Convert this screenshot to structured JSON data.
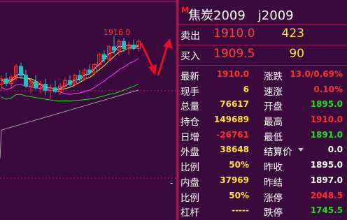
{
  "chart": {
    "high_label": "1916.0",
    "colors": {
      "bg": "#3a0a3d",
      "up": "#ff3030",
      "down": "#20c0c0",
      "ma1": "#ffffff",
      "ma2": "#ffe040",
      "ma3": "#ff40ff",
      "ma4": "#20e020",
      "ma5": "#a0a0a0",
      "arrow": "#e0102a"
    },
    "candles": [
      {
        "o": 1862,
        "h": 1872,
        "l": 1855,
        "c": 1868
      },
      {
        "o": 1868,
        "h": 1875,
        "l": 1860,
        "c": 1863
      },
      {
        "o": 1863,
        "h": 1873,
        "l": 1858,
        "c": 1870
      },
      {
        "o": 1870,
        "h": 1885,
        "l": 1866,
        "c": 1882
      },
      {
        "o": 1882,
        "h": 1886,
        "l": 1868,
        "c": 1872
      },
      {
        "o": 1872,
        "h": 1878,
        "l": 1858,
        "c": 1860
      },
      {
        "o": 1860,
        "h": 1868,
        "l": 1852,
        "c": 1865
      },
      {
        "o": 1865,
        "h": 1872,
        "l": 1856,
        "c": 1858
      },
      {
        "o": 1858,
        "h": 1866,
        "l": 1852,
        "c": 1862
      },
      {
        "o": 1862,
        "h": 1868,
        "l": 1850,
        "c": 1855
      },
      {
        "o": 1855,
        "h": 1862,
        "l": 1846,
        "c": 1858
      },
      {
        "o": 1858,
        "h": 1866,
        "l": 1852,
        "c": 1854
      },
      {
        "o": 1854,
        "h": 1864,
        "l": 1850,
        "c": 1860
      },
      {
        "o": 1860,
        "h": 1870,
        "l": 1856,
        "c": 1866
      },
      {
        "o": 1866,
        "h": 1872,
        "l": 1858,
        "c": 1862
      },
      {
        "o": 1862,
        "h": 1874,
        "l": 1860,
        "c": 1872
      },
      {
        "o": 1872,
        "h": 1878,
        "l": 1864,
        "c": 1868
      },
      {
        "o": 1868,
        "h": 1880,
        "l": 1866,
        "c": 1878
      },
      {
        "o": 1878,
        "h": 1884,
        "l": 1872,
        "c": 1875
      },
      {
        "o": 1875,
        "h": 1886,
        "l": 1872,
        "c": 1884
      },
      {
        "o": 1884,
        "h": 1898,
        "l": 1880,
        "c": 1895
      },
      {
        "o": 1895,
        "h": 1900,
        "l": 1886,
        "c": 1890
      },
      {
        "o": 1890,
        "h": 1906,
        "l": 1888,
        "c": 1904
      },
      {
        "o": 1904,
        "h": 1916,
        "l": 1896,
        "c": 1900
      },
      {
        "o": 1900,
        "h": 1912,
        "l": 1894,
        "c": 1910
      },
      {
        "o": 1910,
        "h": 1914,
        "l": 1898,
        "c": 1902
      },
      {
        "o": 1902,
        "h": 1910,
        "l": 1895,
        "c": 1906
      },
      {
        "o": 1906,
        "h": 1912,
        "l": 1900,
        "c": 1902
      },
      {
        "o": 1902,
        "h": 1912,
        "l": 1899,
        "c": 1910
      }
    ],
    "ylim": [
      1800,
      1925
    ]
  },
  "quote": {
    "marker": "M",
    "title": "焦炭2009　j2009",
    "ask": {
      "label": "卖出",
      "price": "1910.0",
      "volume": "423"
    },
    "bid": {
      "label": "买入",
      "price": "1909.5",
      "volume": "90"
    },
    "rows": [
      {
        "l1": "最新",
        "v1": "1910.0",
        "c1": "red",
        "l2": "涨跌",
        "v2": "13.0/0.69%",
        "c2": "red"
      },
      {
        "l1": "现手",
        "v1": "6",
        "c1": "yellow",
        "l2": "速涨",
        "v2": "0.10%",
        "c2": "red"
      },
      {
        "l1": "总量",
        "v1": "76617",
        "c1": "yellow",
        "l2": "开盘",
        "v2": "1895.0",
        "c2": "green"
      },
      {
        "l1": "持仓",
        "v1": "149689",
        "c1": "yellow",
        "l2": "最高",
        "v2": "1910.0",
        "c2": "red"
      },
      {
        "l1": "日增",
        "v1": "-26761",
        "c1": "red",
        "l2": "最低",
        "v2": "1891.0",
        "c2": "green"
      },
      {
        "l1": "外盘",
        "v1": "38648",
        "c1": "yellow",
        "l2": "结算价",
        "v2": "0.0",
        "c2": "white",
        "arrow": true
      },
      {
        "l1": "比例",
        "v1": "50%",
        "c1": "yellow",
        "l2": "昨收",
        "v2": "1895.0",
        "c2": "white"
      },
      {
        "l1": "内盘",
        "v1": "37969",
        "c1": "yellow",
        "l2": "昨结",
        "v2": "1897.0",
        "c2": "white"
      },
      {
        "l1": "比例",
        "v1": "50%",
        "c1": "yellow",
        "l2": "涨停",
        "v2": "2048.5",
        "c2": "red"
      },
      {
        "l1": "杠杆",
        "v1": "-----",
        "c1": "yellow",
        "l2": "跌停",
        "v2": "1745.5",
        "c2": "green"
      }
    ],
    "dash": "-"
  }
}
